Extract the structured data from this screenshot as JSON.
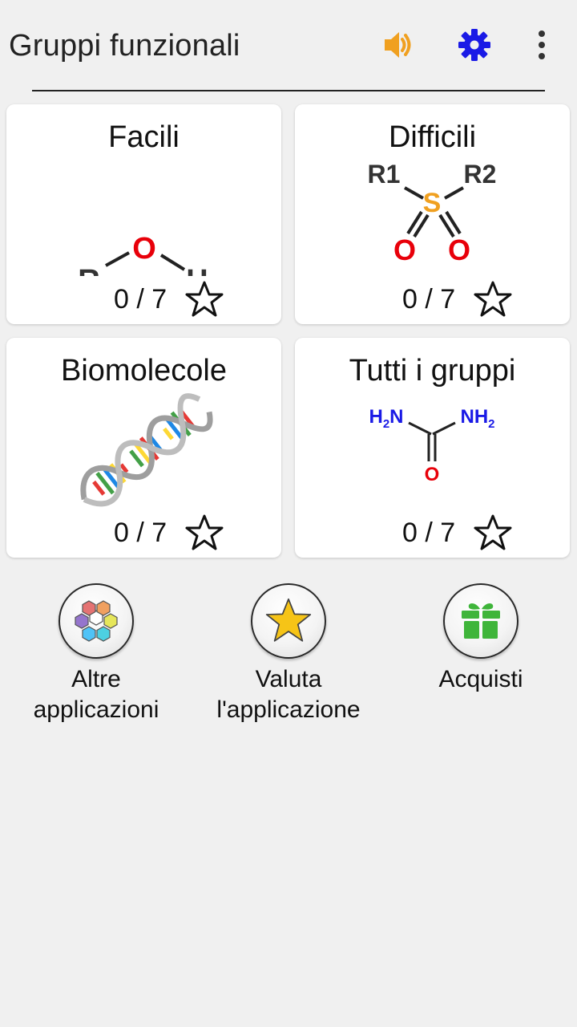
{
  "app_bar": {
    "title": "Gruppi funzionali",
    "icons": [
      "speaker-icon",
      "gear-icon",
      "more-vert-icon"
    ],
    "colors": {
      "speaker": "#f0a020",
      "gear": "#1a1ae6"
    }
  },
  "cards": [
    {
      "title": "Facili",
      "score": "0 / 7",
      "icon": "alcohol-structure-icon"
    },
    {
      "title": "Difficili",
      "score": "0 / 7",
      "icon": "sulfone-structure-icon"
    },
    {
      "title": "Biomolecole",
      "score": "0 / 7",
      "icon": "dna-helix-icon"
    },
    {
      "title": "Tutti i gruppi",
      "score": "0 / 7",
      "icon": "urea-structure-icon"
    }
  ],
  "molecules": {
    "alcohol": {
      "r": "R",
      "o": "O",
      "h": "H"
    },
    "sulfone": {
      "r1": "R1",
      "r2": "R2",
      "s": "S",
      "o": "O"
    },
    "urea": {
      "n": "N",
      "h2": "H",
      "sub2": "2",
      "o": "O"
    }
  },
  "actions": [
    {
      "line1": "Altre",
      "line2": "applicazioni",
      "icon": "hexagon-flower-icon"
    },
    {
      "line1": "Valuta",
      "line2": "l'applicazione",
      "icon": "gold-star-icon"
    },
    {
      "line1": "Acquisti",
      "line2": "",
      "icon": "gift-icon"
    }
  ]
}
